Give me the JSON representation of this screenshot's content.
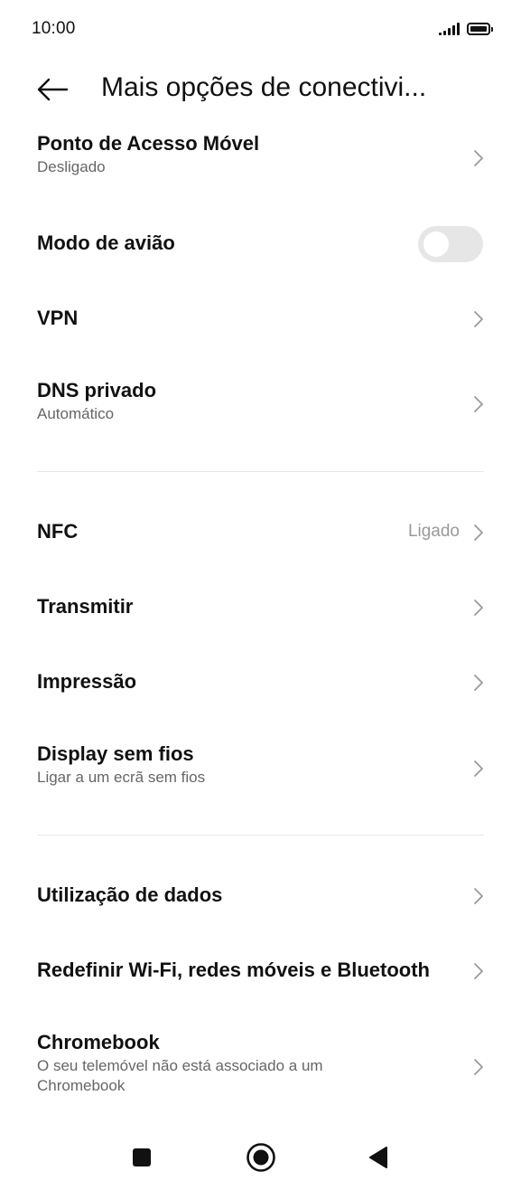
{
  "status_bar": {
    "time": "10:00",
    "icons": [
      "signal-icon",
      "battery-icon"
    ]
  },
  "header": {
    "back_icon": "arrow-left-icon",
    "title": "Mais opções de conectivi..."
  },
  "items": [
    {
      "title": "Ponto de Acesso Móvel",
      "subtitle": "Desligado",
      "control": "chevron"
    },
    {
      "title": "Modo de avião",
      "control": "toggle",
      "toggle_on": false
    },
    {
      "title": "VPN",
      "control": "chevron"
    },
    {
      "title": "DNS privado",
      "subtitle": "Automático",
      "control": "chevron"
    },
    {
      "title": "NFC",
      "value": "Ligado",
      "control": "chevron"
    },
    {
      "title": "Transmitir",
      "control": "chevron"
    },
    {
      "title": "Impressão",
      "control": "chevron"
    },
    {
      "title": "Display sem fios",
      "subtitle": "Ligar a um ecrã sem fios",
      "control": "chevron"
    },
    {
      "title": "Utilização de dados",
      "control": "chevron"
    },
    {
      "title": "Redefinir Wi-Fi, redes móveis e Bluetooth",
      "control": "chevron"
    },
    {
      "title": "Chromebook",
      "subtitle": "O seu telemóvel não está associado a um Chromebook",
      "control": "chevron"
    }
  ],
  "nav_bar": {
    "buttons": [
      "recents-square-icon",
      "home-circle-icon",
      "back-triangle-icon"
    ]
  },
  "colors": {
    "text_primary": "#111111",
    "text_secondary": "#666666",
    "value_text": "#999999",
    "toggle_off_track": "#e6e6e6",
    "divider": "#e8e8e8",
    "chevron": "#9a9a9a"
  }
}
